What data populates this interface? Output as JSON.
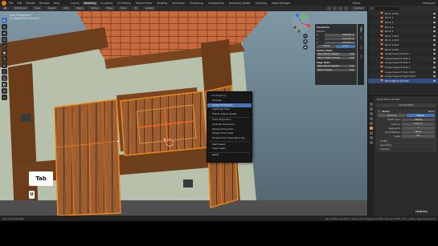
{
  "menubar": {
    "file": "File",
    "edit": "Edit",
    "render": "Render",
    "window": "Window",
    "help": "Help",
    "workspaces": [
      "Layout",
      "Modeling",
      "Sculpting",
      "UV Editing",
      "Texture Paint",
      "Shading",
      "Animation",
      "Rendering",
      "Compositing",
      "Geometry Nodes",
      "Scripting",
      "Asset Manager"
    ],
    "active_workspace": "Modeling",
    "scene": "Scene",
    "layer": "ViewLayer"
  },
  "viewport_header": {
    "mode": "Edit Mode",
    "view": "View",
    "select": "Select",
    "add": "Add",
    "mesh": "Mesh",
    "vertex": "Vertex",
    "edge": "Edge",
    "face": "Face",
    "uv": "UV",
    "orientation": "Global",
    "options": "Options"
  },
  "viewport_info": {
    "line1": "User Perspective",
    "line2": "(1) Wood Block Ver.007"
  },
  "toolbar": {
    "items": [
      "select",
      "cursor",
      "move",
      "rotate",
      "scale",
      "transform",
      "annotate",
      "measure",
      "extrude",
      "inset",
      "bevel",
      "loopcut",
      "knife",
      "polybuild",
      "spin",
      "smooth",
      "shrink",
      "shear",
      "rip"
    ]
  },
  "npanel": {
    "transform_title": "Transform",
    "median_label": "Median:",
    "x": {
      "label": "X",
      "value": "0.02224 m"
    },
    "y": {
      "label": "Y",
      "value": "0.41727 m"
    },
    "z": {
      "label": "Z",
      "value": "0.07443 m"
    },
    "global": "Global",
    "local": "Local",
    "vertex_data_title": "Vertex Data:",
    "vertex_weight": {
      "label": "Mean Bevel Weight",
      "value": "0.00"
    },
    "vertex_crease": {
      "label": "Mean Vertex Crease",
      "value": "0.00"
    },
    "edge_data_title": "Edge Data:",
    "edge_weight": {
      "label": "Mean Bevel Weight",
      "value": "0.00"
    },
    "edge_crease": {
      "label": "Mean Crease",
      "value": "0.00"
    },
    "tabs": [
      "Item",
      "Tool",
      "View",
      "Edit"
    ]
  },
  "uv_menu": {
    "title": "UV Mapping",
    "items": [
      "Unwrap",
      "Smart UV Project",
      "Lightmap Pack",
      "Follow Active Quads",
      "Cube Projection",
      "Cylinder Projection",
      "Sphere Projection",
      "Project from View",
      "Project from View (Bounds)",
      "Mark Seam",
      "Clear Seam",
      "Reset"
    ],
    "highlighted": "Smart UV Project"
  },
  "keys": {
    "tab": "Tab",
    "u": "U"
  },
  "outliner": {
    "items": [
      "Brick 1.001",
      "Brick 2",
      "Brick 3",
      "Brick 4",
      "Brick 5",
      "Brick 1.002",
      "Brick 1.003",
      "Brick 1.004",
      "Brick 1.005",
      "Large Support Post 1",
      "Large Support Post 2",
      "Large Support Post 3",
      "Large Support Post 4",
      "Large Support Post 5.001",
      "Large Support Post 5.002",
      "Wood Block Ver.007"
    ],
    "selected": "Wood Block Ver.007"
  },
  "properties": {
    "object_name": "Wood Block Ver.007",
    "modifier_name": "Bevel",
    "add_modifier": "Add Modifier",
    "modifier_type": "Bevel",
    "vertices": "Vertices",
    "edges": "Edges",
    "width_type": {
      "label": "Width Type",
      "value": "Offset"
    },
    "amount": {
      "label": "Amount",
      "value": "0.01 m"
    },
    "segments": {
      "label": "Segments",
      "value": "1"
    },
    "limit_method": {
      "label": "Limit Method",
      "value": "None"
    },
    "angle": {
      "label": "Angle",
      "value": "30°"
    },
    "subpanels": [
      "Profile",
      "Geometry",
      "Shading"
    ]
  },
  "statusbar": {
    "left": "Pick Shortest Path",
    "right": "Wood Block Ver.007 | Verts 1/54 | Edges 0/1,098 | Faces 0/545 | Tris 1,092 | Objects 1/3,013"
  },
  "watermark": "Udemy",
  "colors": {
    "accent": "#4772b3",
    "selection": "#e87d0d",
    "wood": "#9a5a2c",
    "roof": "#c86a3a",
    "wall": "#b7c1ac"
  }
}
